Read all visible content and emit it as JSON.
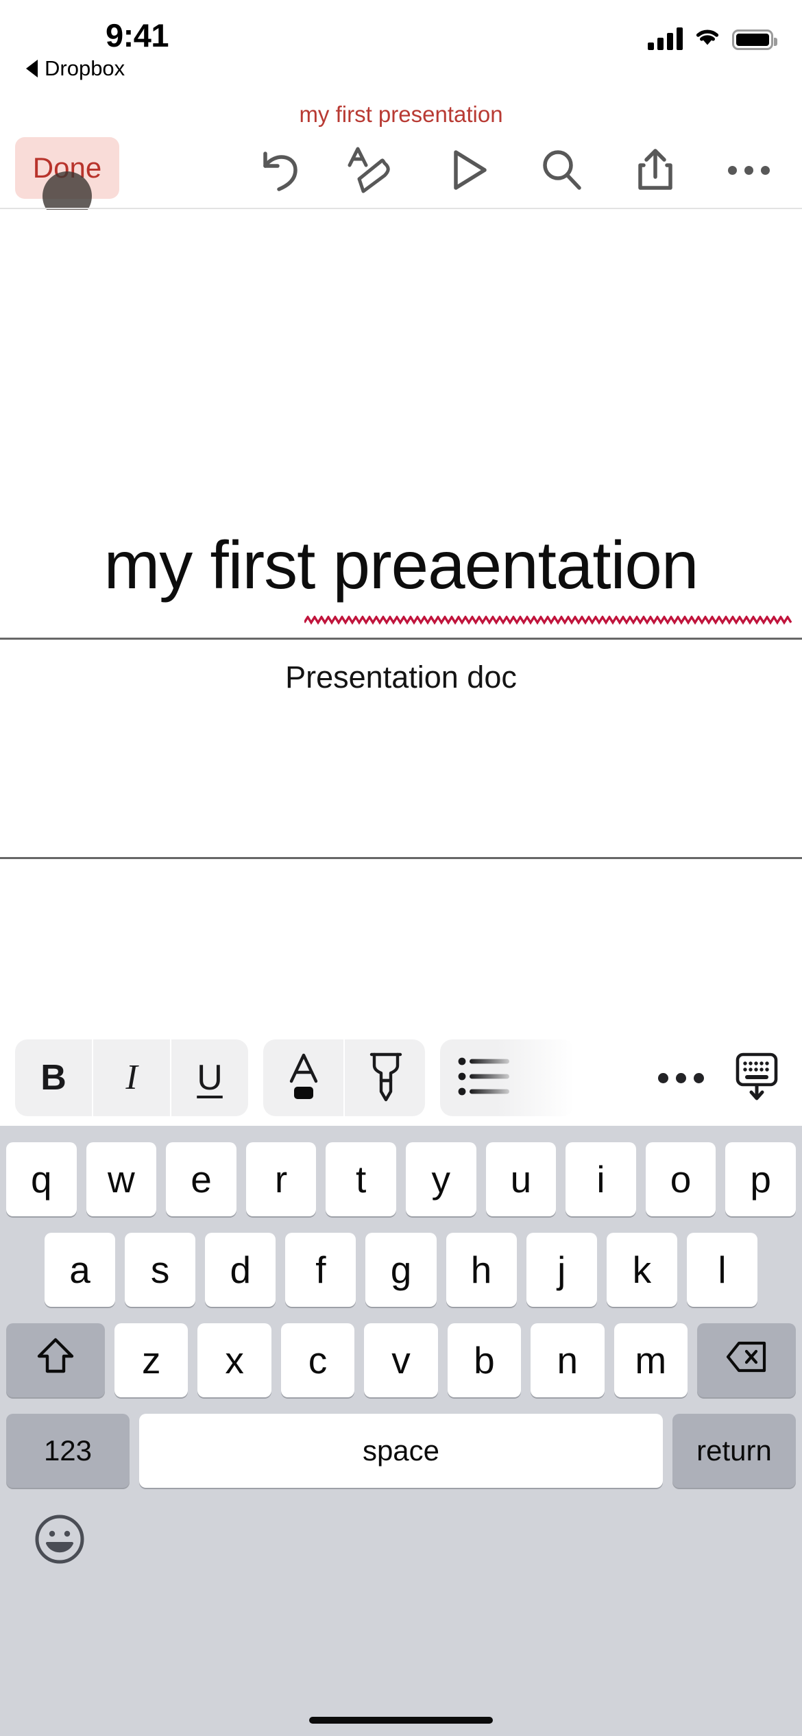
{
  "status_bar": {
    "time": "9:41",
    "cellular_icon": "cellular-signal-icon",
    "wifi_icon": "wifi-icon",
    "battery_icon": "battery-icon"
  },
  "back_link": {
    "label": "Dropbox",
    "icon": "back-caret-icon"
  },
  "doc_title": "my first presentation",
  "toolbar": {
    "done_label": "Done",
    "done_text_color": "#b8332b",
    "done_bg_color": "#f9dcd8",
    "icons": [
      {
        "name": "undo-icon",
        "label": "Undo"
      },
      {
        "name": "format-icon",
        "label": "Format"
      },
      {
        "name": "play-icon",
        "label": "Play"
      },
      {
        "name": "search-icon",
        "label": "Search"
      },
      {
        "name": "share-icon",
        "label": "Share"
      },
      {
        "name": "more-icon",
        "label": "More"
      }
    ]
  },
  "slide": {
    "title": "my first preaentation",
    "title_misspelled_word": "preaentation",
    "spellcheck_color": "#c0143c",
    "subtitle": "Presentation doc"
  },
  "format_bar": {
    "bold_label": "B",
    "italic_label": "I",
    "underline_label": "U",
    "text_color_icon": "text-color-icon",
    "text_color_swatch": "#0b0b0b",
    "highlighter_icon": "highlighter-icon",
    "list_icon": "bullet-list-icon",
    "more_icon": "more-icon",
    "hide_keyboard_icon": "hide-keyboard-icon"
  },
  "keyboard": {
    "row1": [
      "q",
      "w",
      "e",
      "r",
      "t",
      "y",
      "u",
      "i",
      "o",
      "p"
    ],
    "row2": [
      "a",
      "s",
      "d",
      "f",
      "g",
      "h",
      "j",
      "k",
      "l"
    ],
    "row3_letters": [
      "z",
      "x",
      "c",
      "v",
      "b",
      "n",
      "m"
    ],
    "shift_icon": "shift-icon",
    "backspace_icon": "backspace-icon",
    "numbers_label": "123",
    "space_label": "space",
    "return_label": "return",
    "emoji_icon": "emoji-icon",
    "key_bg": "#ffffff",
    "modifier_bg": "#adb0b9",
    "keyboard_bg": "#d1d3d9"
  }
}
